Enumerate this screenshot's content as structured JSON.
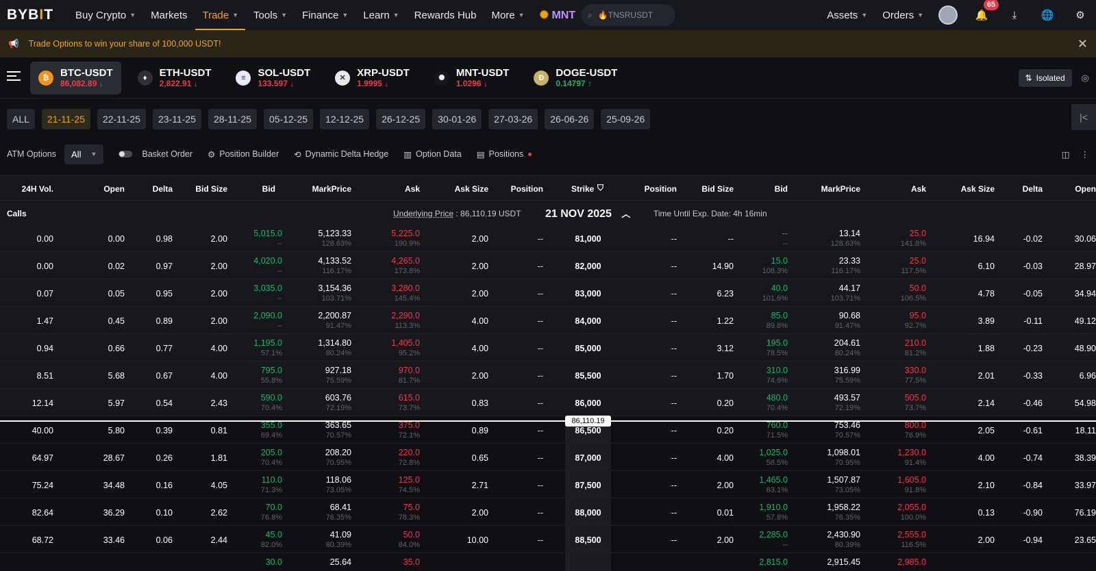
{
  "nav": {
    "logo_a": "BYB",
    "logo_b": "I",
    "logo_c": "T",
    "items": [
      "Buy Crypto",
      "Markets",
      "Trade",
      "Tools",
      "Finance",
      "Learn",
      "Rewards Hub",
      "More"
    ],
    "mnt": "MNT",
    "search": "🔥TNSRUSDT",
    "assets": "Assets",
    "orders": "Orders",
    "notif_count": "65"
  },
  "banner": {
    "text": "Trade Options to win your share of 100,000 USDT!"
  },
  "pairs": [
    {
      "name": "BTC-USDT",
      "price": "86,082.89",
      "dir": "↓",
      "color": "red",
      "coin": "₿",
      "bg": "#f7931a"
    },
    {
      "name": "ETH-USDT",
      "price": "2,822.91",
      "dir": "↓",
      "color": "red",
      "coin": "♦",
      "bg": "#2f3036"
    },
    {
      "name": "SOL-USDT",
      "price": "133.597",
      "dir": "↓",
      "color": "red",
      "coin": "≡",
      "bg": "#e9e9ff"
    },
    {
      "name": "XRP-USDT",
      "price": "1.9995",
      "dir": "↓",
      "color": "red",
      "coin": "✕",
      "bg": "#e8e8e8"
    },
    {
      "name": "MNT-USDT",
      "price": "1.0296",
      "dir": "↓",
      "color": "red",
      "coin": "✺",
      "bg": "#14161a"
    },
    {
      "name": "DOGE-USDT",
      "price": "0.14797",
      "dir": "↑",
      "color": "green",
      "coin": "Ð",
      "bg": "#c9b264"
    }
  ],
  "isolated": "Isolated",
  "expiries": [
    "ALL",
    "21-11-25",
    "22-11-25",
    "23-11-25",
    "28-11-25",
    "05-12-25",
    "12-12-25",
    "26-12-25",
    "30-01-26",
    "27-03-26",
    "26-06-26",
    "25-09-26"
  ],
  "tools": {
    "atm": "ATM Options",
    "atm_value": "All",
    "basket": "Basket Order",
    "builder": "Position Builder",
    "hedge": "Dynamic Delta Hedge",
    "optdata": "Option Data",
    "positions": "Positions"
  },
  "headers": [
    "24H Vol.",
    "Open",
    "Delta",
    "Bid Size",
    "Bid",
    "MarkPrice",
    "Ask",
    "Ask Size",
    "Position",
    "Strike",
    "Position",
    "Bid Size",
    "Bid",
    "MarkPrice",
    "Ask",
    "Ask Size",
    "Delta",
    "Open"
  ],
  "calls": {
    "label": "Calls",
    "underlying_label": "Underlying Price",
    "underlying_value": ": 86,110.19 USDT",
    "date": "21 NOV 2025",
    "time_until": "Time Until Exp. Date:  4h 16min"
  },
  "underlying_marker": "86,110.19",
  "rows": [
    {
      "vol": "0.00",
      "open": "0.00",
      "delta": "0.98",
      "bsize": "2.00",
      "bid": "5,015.0",
      "bidiv": "--",
      "mark": "5,123.33",
      "markiv": "128.63%",
      "ask": "5,225.0",
      "askiv": "190.9%",
      "asize": "2.00",
      "pos": "--",
      "strike": "81,000",
      "ppos": "--",
      "pbsize": "--",
      "pbid": "--",
      "pbidiv": "--",
      "pmark": "13.14",
      "pmarkiv": "128.63%",
      "pask": "25.0",
      "paskiv": "141.8%",
      "pasize": "16.94",
      "pdelta": "-0.02",
      "popen": "30.06"
    },
    {
      "vol": "0.00",
      "open": "0.02",
      "delta": "0.97",
      "bsize": "2.00",
      "bid": "4,020.0",
      "bidiv": "--",
      "mark": "4,133.52",
      "markiv": "116.17%",
      "ask": "4,265.0",
      "askiv": "173.8%",
      "asize": "2.00",
      "pos": "--",
      "strike": "82,000",
      "ppos": "--",
      "pbsize": "14.90",
      "pbid": "15.0",
      "pbidiv": "108.3%",
      "pmark": "23.33",
      "pmarkiv": "116.17%",
      "pask": "25.0",
      "paskiv": "117.5%",
      "pasize": "6.10",
      "pdelta": "-0.03",
      "popen": "28.97"
    },
    {
      "vol": "0.07",
      "open": "0.05",
      "delta": "0.95",
      "bsize": "2.00",
      "bid": "3,035.0",
      "bidiv": "--",
      "mark": "3,154.36",
      "markiv": "103.71%",
      "ask": "3,280.0",
      "askiv": "145.4%",
      "asize": "2.00",
      "pos": "--",
      "strike": "83,000",
      "ppos": "--",
      "pbsize": "6.23",
      "pbid": "40.0",
      "pbidiv": "101.6%",
      "pmark": "44.17",
      "pmarkiv": "103.71%",
      "pask": "50.0",
      "paskiv": "106.5%",
      "pasize": "4.78",
      "pdelta": "-0.05",
      "popen": "34.94"
    },
    {
      "vol": "1.47",
      "open": "0.45",
      "delta": "0.89",
      "bsize": "2.00",
      "bid": "2,090.0",
      "bidiv": "--",
      "mark": "2,200.87",
      "markiv": "91.47%",
      "ask": "2,290.0",
      "askiv": "113.3%",
      "asize": "4.00",
      "pos": "--",
      "strike": "84,000",
      "ppos": "--",
      "pbsize": "1.22",
      "pbid": "85.0",
      "pbidiv": "89.8%",
      "pmark": "90.68",
      "pmarkiv": "91.47%",
      "pask": "95.0",
      "paskiv": "92.7%",
      "pasize": "3.89",
      "pdelta": "-0.11",
      "popen": "49.12"
    },
    {
      "vol": "0.94",
      "open": "0.66",
      "delta": "0.77",
      "bsize": "4.00",
      "bid": "1,195.0",
      "bidiv": "57.1%",
      "mark": "1,314.80",
      "markiv": "80.24%",
      "ask": "1,405.0",
      "askiv": "95.2%",
      "asize": "4.00",
      "pos": "--",
      "strike": "85,000",
      "ppos": "--",
      "pbsize": "3.12",
      "pbid": "195.0",
      "pbidiv": "78.5%",
      "pmark": "204.61",
      "pmarkiv": "80.24%",
      "pask": "210.0",
      "paskiv": "81.2%",
      "pasize": "1.88",
      "pdelta": "-0.23",
      "popen": "48.90"
    },
    {
      "vol": "8.51",
      "open": "5.68",
      "delta": "0.67",
      "bsize": "4.00",
      "bid": "795.0",
      "bidiv": "55.8%",
      "mark": "927.18",
      "markiv": "75.59%",
      "ask": "970.0",
      "askiv": "81.7%",
      "asize": "2.00",
      "pos": "--",
      "strike": "85,500",
      "ppos": "--",
      "pbsize": "1.70",
      "pbid": "310.0",
      "pbidiv": "74.6%",
      "pmark": "316.99",
      "pmarkiv": "75.59%",
      "pask": "330.0",
      "paskiv": "77.5%",
      "pasize": "2.01",
      "pdelta": "-0.33",
      "popen": "6.96"
    },
    {
      "vol": "12.14",
      "open": "5.97",
      "delta": "0.54",
      "bsize": "2.43",
      "bid": "590.0",
      "bidiv": "70.4%",
      "mark": "603.76",
      "markiv": "72.19%",
      "ask": "615.0",
      "askiv": "73.7%",
      "asize": "0.83",
      "pos": "--",
      "strike": "86,000",
      "ppos": "--",
      "pbsize": "0.20",
      "pbid": "480.0",
      "pbidiv": "70.4%",
      "pmark": "493.57",
      "pmarkiv": "72.19%",
      "pask": "505.0",
      "paskiv": "73.7%",
      "pasize": "2.14",
      "pdelta": "-0.46",
      "popen": "54.98"
    },
    {
      "vol": "40.00",
      "open": "5.80",
      "delta": "0.39",
      "bsize": "0.81",
      "bid": "355.0",
      "bidiv": "69.4%",
      "mark": "363.65",
      "markiv": "70.57%",
      "ask": "375.0",
      "askiv": "72.1%",
      "asize": "0.89",
      "pos": "--",
      "strike": "86,500",
      "ppos": "--",
      "pbsize": "0.20",
      "pbid": "760.0",
      "pbidiv": "71.5%",
      "pmark": "753.46",
      "pmarkiv": "70.57%",
      "pask": "800.0",
      "paskiv": "76.9%",
      "pasize": "2.05",
      "pdelta": "-0.61",
      "popen": "18.11"
    },
    {
      "vol": "64.97",
      "open": "28.67",
      "delta": "0.26",
      "bsize": "1.81",
      "bid": "205.0",
      "bidiv": "70.4%",
      "mark": "208.20",
      "markiv": "70.95%",
      "ask": "220.0",
      "askiv": "72.8%",
      "asize": "0.65",
      "pos": "--",
      "strike": "87,000",
      "ppos": "--",
      "pbsize": "4.00",
      "pbid": "1,025.0",
      "pbidiv": "58.5%",
      "pmark": "1,098.01",
      "pmarkiv": "70.95%",
      "pask": "1,230.0",
      "paskiv": "91.4%",
      "pasize": "4.00",
      "pdelta": "-0.74",
      "popen": "38.39"
    },
    {
      "vol": "75.24",
      "open": "34.48",
      "delta": "0.16",
      "bsize": "4.05",
      "bid": "110.0",
      "bidiv": "71.3%",
      "mark": "118.06",
      "markiv": "73.05%",
      "ask": "125.0",
      "askiv": "74.5%",
      "asize": "2.71",
      "pos": "--",
      "strike": "87,500",
      "ppos": "--",
      "pbsize": "2.00",
      "pbid": "1,465.0",
      "pbidiv": "63.1%",
      "pmark": "1,507.87",
      "pmarkiv": "73.05%",
      "pask": "1,605.0",
      "paskiv": "91.8%",
      "pasize": "2.10",
      "pdelta": "-0.84",
      "popen": "33.97"
    },
    {
      "vol": "82.64",
      "open": "36.29",
      "delta": "0.10",
      "bsize": "2.62",
      "bid": "70.0",
      "bidiv": "76.8%",
      "mark": "68.41",
      "markiv": "76.35%",
      "ask": "75.0",
      "askiv": "78.3%",
      "asize": "2.00",
      "pos": "--",
      "strike": "88,000",
      "ppos": "--",
      "pbsize": "0.01",
      "pbid": "1,910.0",
      "pbidiv": "57.8%",
      "pmark": "1,958.22",
      "pmarkiv": "76.35%",
      "pask": "2,055.0",
      "paskiv": "100.0%",
      "pasize": "0.13",
      "pdelta": "-0.90",
      "popen": "76.19"
    },
    {
      "vol": "68.72",
      "open": "33.46",
      "delta": "0.06",
      "bsize": "2.44",
      "bid": "45.0",
      "bidiv": "82.0%",
      "mark": "41.09",
      "markiv": "80.39%",
      "ask": "50.0",
      "askiv": "84.0%",
      "asize": "10.00",
      "pos": "--",
      "strike": "88,500",
      "ppos": "--",
      "pbsize": "2.00",
      "pbid": "2,285.0",
      "pbidiv": "--",
      "pmark": "2,430.90",
      "pmarkiv": "80.39%",
      "pask": "2,555.0",
      "paskiv": "116.5%",
      "pasize": "2.00",
      "pdelta": "-0.94",
      "popen": "23.65"
    },
    {
      "vol": "",
      "open": "",
      "delta": "",
      "bsize": "",
      "bid": "30.0",
      "bidiv": "",
      "mark": "25.64",
      "markiv": "",
      "ask": "35.0",
      "askiv": "",
      "asize": "",
      "pos": "",
      "strike": "",
      "ppos": "",
      "pbsize": "",
      "pbid": "2,815.0",
      "pbidiv": "",
      "pmark": "2,915.45",
      "pmarkiv": "",
      "pask": "2,985.0",
      "paskiv": "",
      "pasize": "",
      "pdelta": "",
      "popen": ""
    }
  ]
}
